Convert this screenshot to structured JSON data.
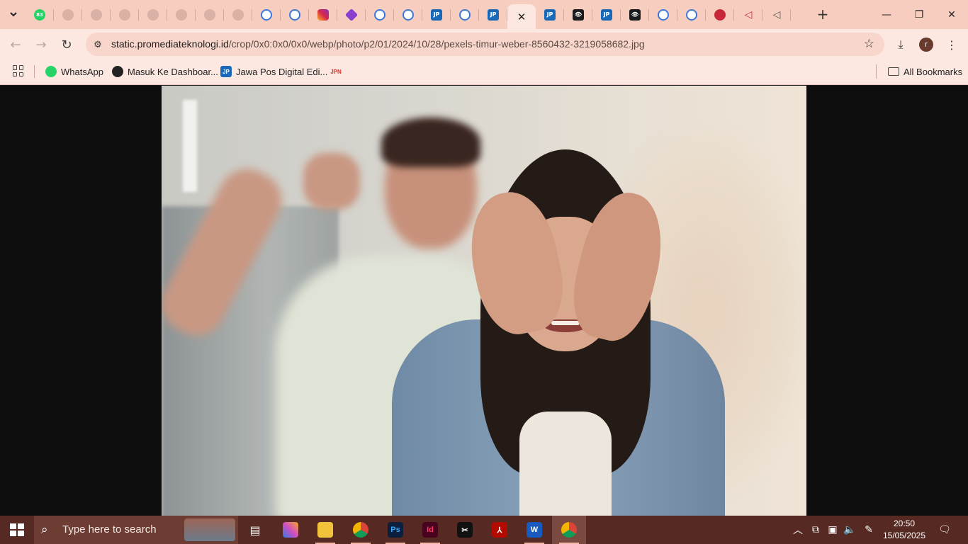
{
  "browser": {
    "tabs": [
      {
        "icon": "whatsapp-icon",
        "badge": "83",
        "state": "normal"
      },
      {
        "icon": "blank-page-icon",
        "state": "disabled"
      },
      {
        "icon": "blank-page-icon",
        "state": "disabled"
      },
      {
        "icon": "blank-page-icon",
        "state": "disabled"
      },
      {
        "icon": "blank-page-icon",
        "state": "disabled"
      },
      {
        "icon": "blank-page-icon",
        "state": "disabled"
      },
      {
        "icon": "blank-page-icon",
        "state": "disabled"
      },
      {
        "icon": "blank-page-icon",
        "state": "disabled"
      },
      {
        "icon": "google-icon",
        "state": "normal"
      },
      {
        "icon": "google-icon",
        "state": "normal"
      },
      {
        "icon": "instagram-icon",
        "state": "normal"
      },
      {
        "icon": "app-icon",
        "state": "normal"
      },
      {
        "icon": "google-icon",
        "state": "normal"
      },
      {
        "icon": "google-icon",
        "state": "normal"
      },
      {
        "icon": "jawapos-icon",
        "state": "normal"
      },
      {
        "icon": "google-icon",
        "state": "normal"
      },
      {
        "icon": "jawapos-icon",
        "state": "normal"
      },
      {
        "icon": "close-icon",
        "state": "active"
      },
      {
        "icon": "jawapos-icon",
        "state": "normal"
      },
      {
        "icon": "eye-icon",
        "state": "normal"
      },
      {
        "icon": "jawapos-icon",
        "state": "normal"
      },
      {
        "icon": "eye-icon",
        "state": "normal"
      },
      {
        "icon": "google-icon",
        "state": "normal"
      },
      {
        "icon": "google-icon",
        "state": "normal"
      },
      {
        "icon": "red-icon",
        "state": "normal"
      },
      {
        "icon": "triangle-icon",
        "state": "normal"
      },
      {
        "icon": "triangle-icon",
        "state": "normal"
      }
    ],
    "tab_labels": {
      "wa_badge": "83",
      "jp": "JP",
      "eye": "👁"
    },
    "address": {
      "host": "static.promediateknologi.id",
      "path": "/crop/0x0:0x0/0x0/webp/photo/p2/01/2024/10/28/pexels-timur-weber-8560432-3219058682.jpg"
    },
    "profile_initial": "r",
    "bookmarks": [
      {
        "label": "WhatsApp",
        "icon": "whatsapp-icon"
      },
      {
        "label": "Masuk Ke Dashboar...",
        "icon": "dashboard-icon"
      },
      {
        "label": "Jawa Pos Digital Edi...",
        "icon": "jawapos-icon"
      },
      {
        "label": "",
        "icon": "jpnn-icon"
      }
    ],
    "all_bookmarks_label": "All Bookmarks"
  },
  "content": {
    "image_description": "Photo: woman with hands in hair, man shouting behind her"
  },
  "taskbar": {
    "search_placeholder": "Type here to search",
    "apps": [
      {
        "name": "task-view-icon"
      },
      {
        "name": "copilot-icon"
      },
      {
        "name": "file-explorer-icon"
      },
      {
        "name": "chrome-icon"
      },
      {
        "name": "photoshop-icon",
        "label": "Ps"
      },
      {
        "name": "indesign-icon",
        "label": "Id"
      },
      {
        "name": "capcut-icon"
      },
      {
        "name": "acrobat-icon"
      },
      {
        "name": "word-icon",
        "label": "W"
      },
      {
        "name": "chrome-profile-icon"
      }
    ],
    "time": "20:50",
    "date": "15/05/2025"
  },
  "colors": {
    "tabstrip": "#f6cdbf",
    "toolbar": "#fde8e1",
    "taskbar": "#562a22"
  }
}
